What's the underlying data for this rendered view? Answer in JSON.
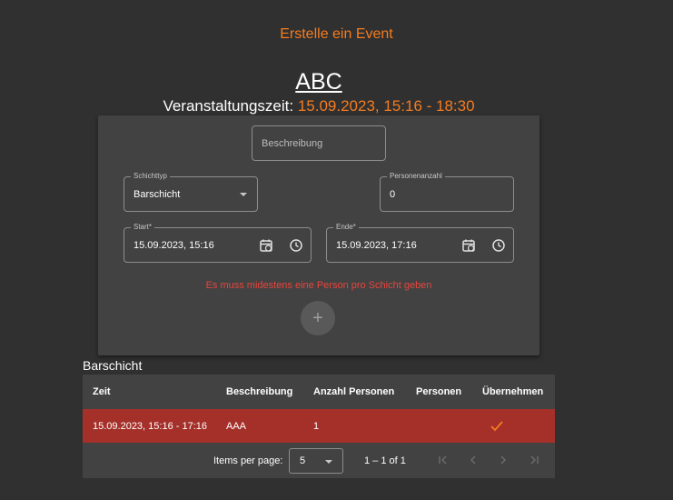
{
  "header": {
    "page_title": "Erstelle ein Event",
    "event_name": "ABC",
    "time_label": "Veranstaltungszeit:",
    "time_value": "15.09.2023, 15:16 - 18:30"
  },
  "form": {
    "description": {
      "placeholder": "Beschreibung"
    },
    "shift_type": {
      "label": "Schichttyp",
      "value": "Barschicht"
    },
    "person_count": {
      "label": "Personenanzahl",
      "value": "0"
    },
    "start": {
      "label": "Start*",
      "value": "15.09.2023, 15:16"
    },
    "end": {
      "label": "Ende*",
      "value": "15.09.2023, 17:16"
    },
    "error": "Es muss midestens eine Person pro Schicht geben",
    "add_symbol": "+"
  },
  "table": {
    "title": "Barschicht",
    "columns": [
      "Zeit",
      "Beschreibung",
      "Anzahl Personen",
      "Personen",
      "Übernehmen"
    ],
    "rows": [
      {
        "time": "15.09.2023, 15:16 - 17:16",
        "description": "AAA",
        "count": "1",
        "persons": "",
        "take": "check-icon"
      }
    ],
    "paginator": {
      "items_label": "Items per page:",
      "page_size": "5",
      "range": "1 – 1 of 1"
    }
  },
  "colors": {
    "accent": "#f57c1f",
    "error": "#e8453c",
    "row_highlight": "#a5302a",
    "background": "#303030",
    "card": "#424242"
  }
}
